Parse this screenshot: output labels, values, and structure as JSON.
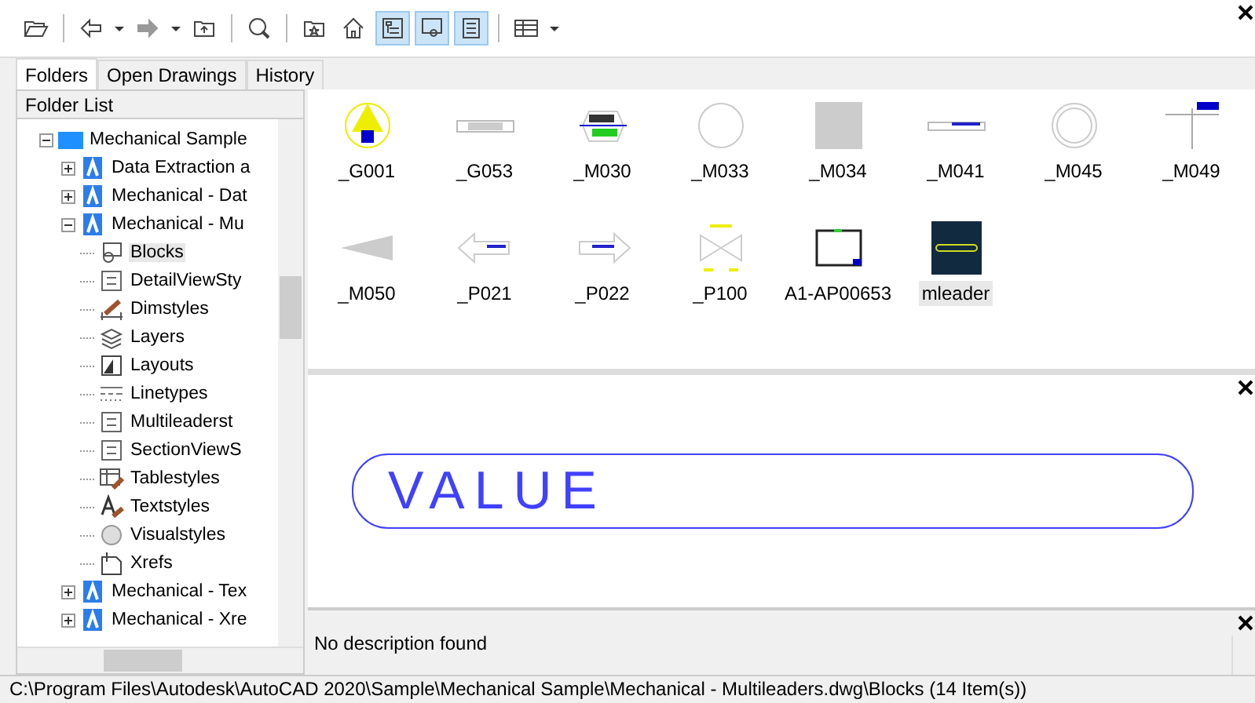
{
  "toolbar": [
    {
      "kind": "open",
      "on": false
    },
    {
      "kind": "sep"
    },
    {
      "kind": "back",
      "on": false
    },
    {
      "kind": "drop"
    },
    {
      "kind": "forward",
      "on": false
    },
    {
      "kind": "drop"
    },
    {
      "kind": "up",
      "on": false
    },
    {
      "kind": "sep"
    },
    {
      "kind": "search",
      "on": false
    },
    {
      "kind": "sep"
    },
    {
      "kind": "favorites",
      "on": false
    },
    {
      "kind": "home",
      "on": false
    },
    {
      "kind": "tree",
      "on": true
    },
    {
      "kind": "preview",
      "on": true
    },
    {
      "kind": "description",
      "on": true
    },
    {
      "kind": "sep"
    },
    {
      "kind": "views",
      "on": false
    },
    {
      "kind": "drop"
    }
  ],
  "tabs": [
    {
      "label": "Folders",
      "selected": true
    },
    {
      "label": "Open Drawings",
      "selected": false
    },
    {
      "label": "History",
      "selected": false
    }
  ],
  "folder_list": {
    "title": "Folder List",
    "tree": [
      {
        "label": "Mechanical Sample",
        "kind": "folder",
        "expanded": true,
        "children": [
          {
            "label": "Data Extraction a",
            "kind": "drawing",
            "expanded": false
          },
          {
            "label": "Mechanical - Dat",
            "kind": "drawing",
            "expanded": false
          },
          {
            "label": "Mechanical - Mu",
            "kind": "drawing",
            "expanded": true,
            "children": [
              {
                "label": "Blocks",
                "kind": "blocks",
                "selected": true
              },
              {
                "label": "DetailViewSty",
                "kind": "detail",
                "selected": false
              },
              {
                "label": "Dimstyles",
                "kind": "dim",
                "selected": false
              },
              {
                "label": "Layers",
                "kind": "layers",
                "selected": false
              },
              {
                "label": "Layouts",
                "kind": "layouts",
                "selected": false
              },
              {
                "label": "Linetypes",
                "kind": "linetypes",
                "selected": false
              },
              {
                "label": "Multileaderst",
                "kind": "mleader",
                "selected": false
              },
              {
                "label": "SectionViewS",
                "kind": "section",
                "selected": false
              },
              {
                "label": "Tablestyles",
                "kind": "table",
                "selected": false
              },
              {
                "label": "Textstyles",
                "kind": "text",
                "selected": false
              },
              {
                "label": "Visualstyles",
                "kind": "visual",
                "selected": false
              },
              {
                "label": "Xrefs",
                "kind": "xref",
                "selected": false
              }
            ]
          },
          {
            "label": "Mechanical - Tex",
            "kind": "drawing",
            "expanded": false
          },
          {
            "label": "Mechanical - Xre",
            "kind": "drawing",
            "expanded": false
          }
        ]
      }
    ]
  },
  "blocks": [
    {
      "label": "_G001",
      "kind": "compass",
      "selected": false
    },
    {
      "label": "_G053",
      "kind": "bar",
      "selected": false
    },
    {
      "label": "_M030",
      "kind": "tag",
      "selected": false
    },
    {
      "label": "_M033",
      "kind": "circle",
      "selected": false
    },
    {
      "label": "_M034",
      "kind": "square",
      "selected": false
    },
    {
      "label": "_M041",
      "kind": "leader",
      "selected": false
    },
    {
      "label": "_M045",
      "kind": "ring",
      "selected": false
    },
    {
      "label": "_M049",
      "kind": "cross",
      "selected": false
    },
    {
      "label": "_M050",
      "kind": "triangle",
      "selected": false
    },
    {
      "label": "_P021",
      "kind": "arrow-left",
      "selected": false
    },
    {
      "label": "_P022",
      "kind": "arrow-right",
      "selected": false
    },
    {
      "label": "_P100",
      "kind": "valve",
      "selected": false
    },
    {
      "label": "A1-AP00653",
      "kind": "frame",
      "selected": false
    },
    {
      "label": "mleader",
      "kind": "dark",
      "selected": true
    }
  ],
  "preview": {
    "text": "VALUE"
  },
  "description": {
    "text": "No description found"
  },
  "status_bar": "C:\\Program Files\\Autodesk\\AutoCAD 2020\\Sample\\Mechanical Sample\\Mechanical - Multileaders.dwg\\Blocks (14 Item(s))"
}
